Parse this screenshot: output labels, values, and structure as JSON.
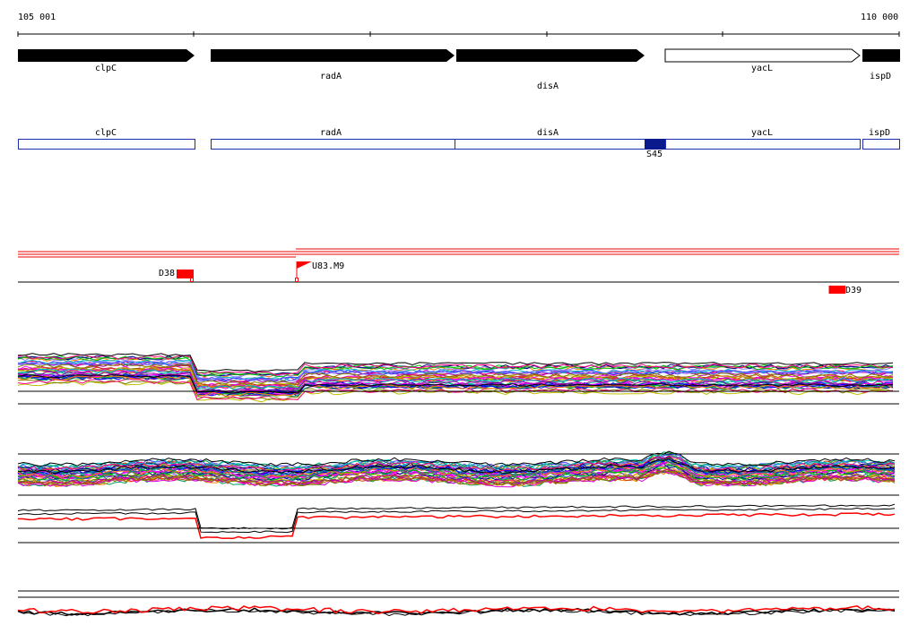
{
  "coords": {
    "start": "105 001",
    "end": "110 000"
  },
  "colors": {
    "arrow_fill": "#000000",
    "box_border": "#1a2fb0",
    "box_fill_dark": "#0b1a8c",
    "flag_red": "#ff0000"
  },
  "genes": [
    {
      "name": "clpC"
    },
    {
      "name": "radA"
    },
    {
      "name": "disA"
    },
    {
      "name": "yacL"
    },
    {
      "name": "ispD"
    }
  ],
  "gene_boxes": [
    {
      "name": "clpC"
    },
    {
      "name": "radA"
    },
    {
      "name": "disA"
    },
    {
      "name": "yacL"
    },
    {
      "name": "ispD"
    }
  ],
  "box_marker": {
    "label": "S45"
  },
  "flags": [
    {
      "label": "D38"
    },
    {
      "label": "U83.M9"
    },
    {
      "label": "D39"
    }
  ]
}
